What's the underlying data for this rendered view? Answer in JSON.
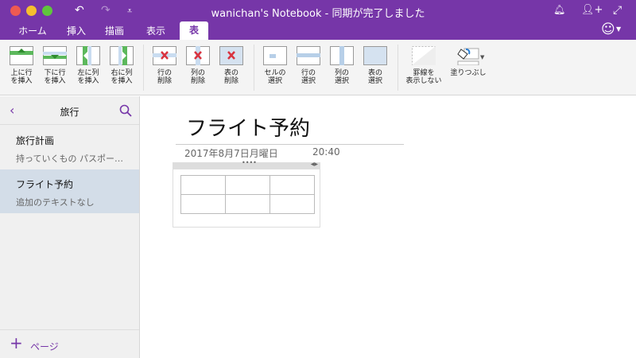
{
  "window": {
    "title": "wanichan's Notebook - 同期が完了しました"
  },
  "tabs": [
    {
      "label": "ホーム"
    },
    {
      "label": "挿入"
    },
    {
      "label": "描画"
    },
    {
      "label": "表示"
    },
    {
      "label": "表"
    }
  ],
  "ribbon": [
    {
      "label": "上に行\nを挿入"
    },
    {
      "label": "下に行\nを挿入"
    },
    {
      "label": "左に列\nを挿入"
    },
    {
      "label": "右に列\nを挿入"
    },
    {
      "label": "行の\n削除"
    },
    {
      "label": "列の\n削除"
    },
    {
      "label": "表の\n削除"
    },
    {
      "label": "セルの\n選択"
    },
    {
      "label": "行の\n選択"
    },
    {
      "label": "列の\n選択"
    },
    {
      "label": "表の\n選択"
    },
    {
      "label": "罫線を\n表示しない"
    },
    {
      "label": "塗りつぶし"
    }
  ],
  "sidebar": {
    "section": "旅行",
    "pages": [
      {
        "title": "旅行計画",
        "preview": "持っていくもの パスポー…"
      },
      {
        "title": "フライト予約",
        "preview": "追加のテキストなし"
      }
    ],
    "add_page": "ページ"
  },
  "page": {
    "title": "フライト予約",
    "date": "2017年8月7日月曜日",
    "time": "20:40"
  },
  "colors": {
    "accent": "#7636a8",
    "selected": "#d3dde8"
  }
}
